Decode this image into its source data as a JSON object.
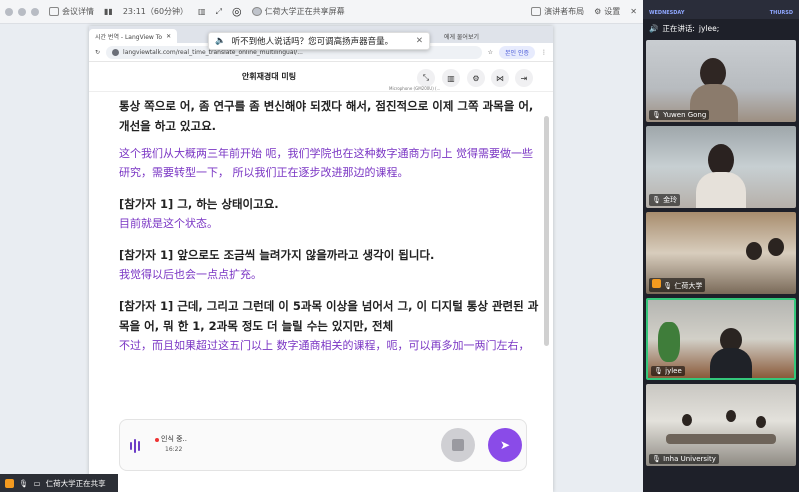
{
  "meeting_toolbar": {
    "detail_label": "会议详情",
    "time_label": "23:11（60分钟）",
    "sharing_title": "仁荷大学正在共享屏幕",
    "presenter_layout_label": "演讲者布局",
    "settings_label": "设置"
  },
  "browser": {
    "tab1_title": "시간 번역 - LangView To",
    "tab2_title": "에게 물어보기",
    "url": "langviewtalk.com/real_time_translate_online_multilingual/...",
    "cert_label": "본인 인증"
  },
  "notification": {
    "text": "听不到他人说话吗？您可调高扬声器音量。"
  },
  "app": {
    "title": "안휘재경대 미팅",
    "mic_label": "Microphone (GM200U) (..."
  },
  "transcript": [
    {
      "ko": "통상 쪽으로 어, 좀 연구를 좀 변신해야 되겠다 해서, 점진적으로 이제 그쪽 과목을 어, 개선을 하고 있고요.",
      "zh": "这个我们从大概两三年前开始 呃，我们学院也在这种数字通商方向上 觉得需要做一些研究，需要转型一下， 所以我们正在逐步改进那边的课程。"
    },
    {
      "ko": "[참가자 1] 그, 하는 상태이고요.",
      "zh": "目前就是这个状态。"
    },
    {
      "ko": "[참가자 1] 앞으로도 조금씩 늘려가지 않을까라고 생각이 됩니다.",
      "zh": "我觉得以后也会一点点扩充。"
    },
    {
      "ko": "[참가자 1] 근데, 그리고 그런데 이 5과목 이상을 넘어서 그, 이 디지털 통상 관련된 과목을 어, 뭐 한 1, 2과목 정도 더 늘릴 수는 있지만, 전체",
      "zh": "不过，而且如果超过这五门以上 数字通商相关的课程，呃，可以再多加一两门左右，"
    }
  ],
  "recorder": {
    "status_label": "인식 중..",
    "elapsed": "16:22"
  },
  "share_badge": "仁荷大学正在共享",
  "gallery": {
    "day1": "WEDNESDAY",
    "day2": "THURSD",
    "speaking_label": "正在讲话:",
    "speaking_name": "jylee;",
    "participants": [
      {
        "name": "Yuwen Gong"
      },
      {
        "name": "金玲"
      },
      {
        "name": "仁荷大学"
      },
      {
        "name": "jylee"
      },
      {
        "name": "Inha University"
      }
    ]
  },
  "colors": {
    "accent": "#8a4be8",
    "translation_text": "#7a35c4",
    "gallery_bg": "#1e2029"
  }
}
